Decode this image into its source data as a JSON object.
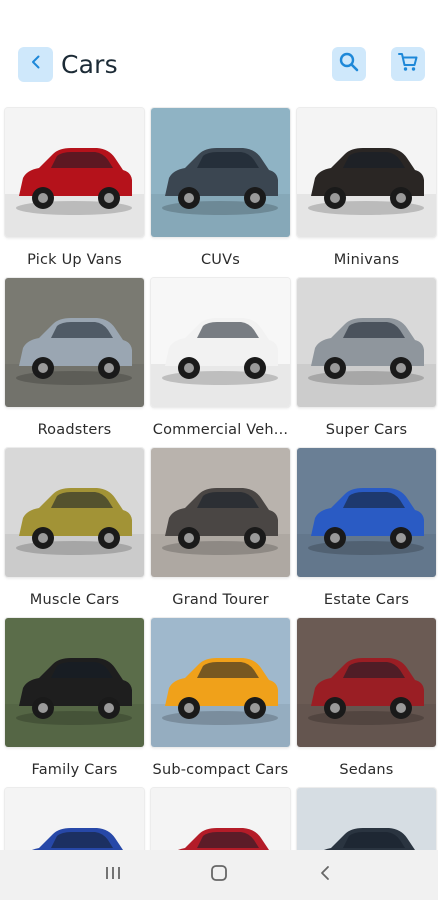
{
  "header": {
    "title": "Cars",
    "back_icon": "chevron-left-icon",
    "search_icon": "search-icon",
    "cart_icon": "cart-icon",
    "accent_bg": "#cfe8fb",
    "accent_fg": "#1e88d8"
  },
  "categories": [
    {
      "label": "Pick Up Vans",
      "color": "#b5121b",
      "bg": "#f4f4f4"
    },
    {
      "label": "CUVs",
      "color": "#3b4651",
      "bg": "#8fb3c4"
    },
    {
      "label": "Minivans",
      "color": "#2a2624",
      "bg": "#f4f4f4"
    },
    {
      "label": "Roadsters",
      "color": "#9aa6b2",
      "bg": "#7a7a72"
    },
    {
      "label": "Commercial Veh...",
      "color": "#f2f2f2",
      "bg": "#f7f7f7"
    },
    {
      "label": "Super Cars",
      "color": "#8f969d",
      "bg": "#d9d9d9"
    },
    {
      "label": "Muscle Cars",
      "color": "#a29336",
      "bg": "#d8d8d8"
    },
    {
      "label": "Grand Tourer",
      "color": "#4a4644",
      "bg": "#b9b3ad"
    },
    {
      "label": "Estate Cars",
      "color": "#2a5bc4",
      "bg": "#6a7f95"
    },
    {
      "label": "Family Cars",
      "color": "#1e1e1e",
      "bg": "#5b6d4a"
    },
    {
      "label": "Sub-compact Cars",
      "color": "#f0a11a",
      "bg": "#9fb8cc"
    },
    {
      "label": "Sedans",
      "color": "#9a1e24",
      "bg": "#6b5b54"
    },
    {
      "label": "",
      "color": "#2748a8",
      "bg": "#f4f4f4"
    },
    {
      "label": "",
      "color": "#b41c28",
      "bg": "#f4f4f4"
    },
    {
      "label": "",
      "color": "#2a3440",
      "bg": "#d6dde3"
    }
  ],
  "navbar": {
    "recents_icon": "recents-icon",
    "home_icon": "home-icon",
    "back_icon": "back-nav-icon"
  }
}
